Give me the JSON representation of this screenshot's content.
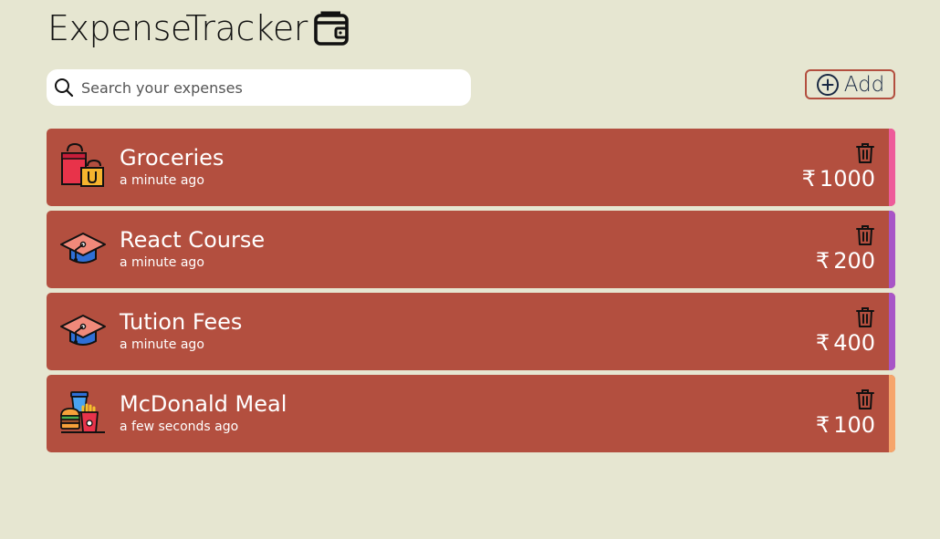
{
  "header": {
    "title": "ExpenseTracker",
    "icon": "wallet-icon"
  },
  "search": {
    "placeholder": "Search your expenses",
    "value": "",
    "icon": "search-icon"
  },
  "add_button": {
    "label": "Add",
    "icon": "plus-circle-icon",
    "border_color": "#b34f3f"
  },
  "colors": {
    "background": "#e6e6d1",
    "card": "#b34f3f"
  },
  "expenses": [
    {
      "title": "Groceries",
      "time": "a minute ago",
      "currency": "₹",
      "amount": "1000",
      "icon": "shopping-bags-icon",
      "stripe_color": "#ee5b9a"
    },
    {
      "title": "React Course",
      "time": "a minute ago",
      "currency": "₹",
      "amount": "200",
      "icon": "graduation-cap-icon",
      "stripe_color": "#a855c7"
    },
    {
      "title": "Tution Fees",
      "time": "a minute ago",
      "currency": "₹",
      "amount": "400",
      "icon": "graduation-cap-icon",
      "stripe_color": "#a855c7"
    },
    {
      "title": "McDonald Meal",
      "time": "a few seconds ago",
      "currency": "₹",
      "amount": "100",
      "icon": "fast-food-icon",
      "stripe_color": "#f6a56b"
    }
  ]
}
